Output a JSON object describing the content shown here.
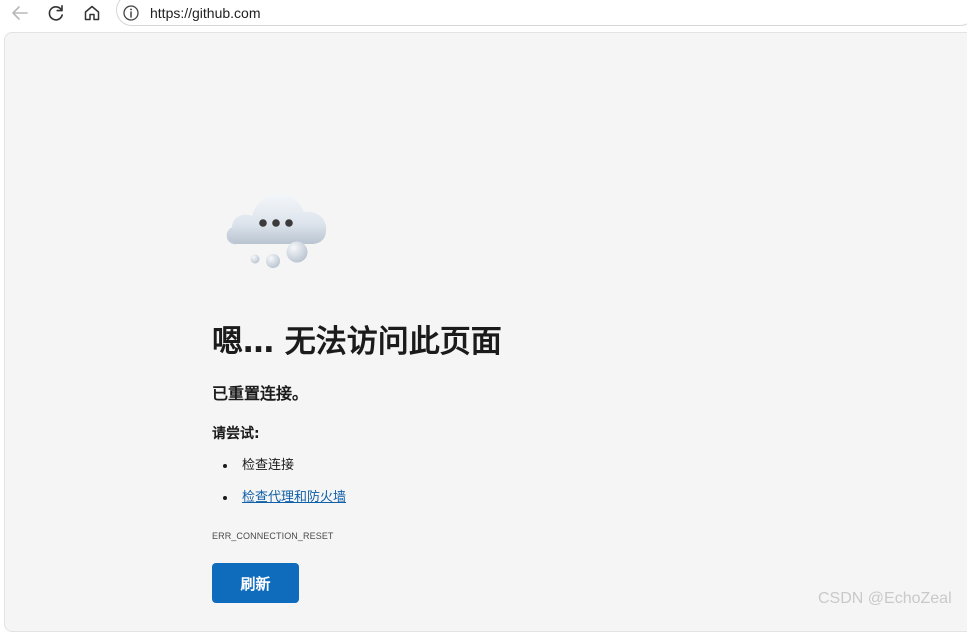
{
  "browser": {
    "url": "https://github.com",
    "icons": {
      "back": "back-arrow-icon",
      "refresh": "refresh-icon",
      "home": "home-icon",
      "site_info": "info-icon"
    }
  },
  "error_page": {
    "illustration": "cloud-icon",
    "headline": "嗯… 无法访问此页面",
    "subtitle": "已重置连接。",
    "try_label": "请尝试:",
    "suggestions": [
      {
        "text": "检查连接",
        "is_link": false
      },
      {
        "text": "检查代理和防火墙",
        "is_link": true
      }
    ],
    "error_code": "ERR_CONNECTION_RESET",
    "refresh_button": "刷新",
    "colors": {
      "accent": "#0f6cbd",
      "link": "#0f5fa8",
      "background": "#f5f5f5"
    }
  },
  "watermark": "CSDN @EchoZeal"
}
